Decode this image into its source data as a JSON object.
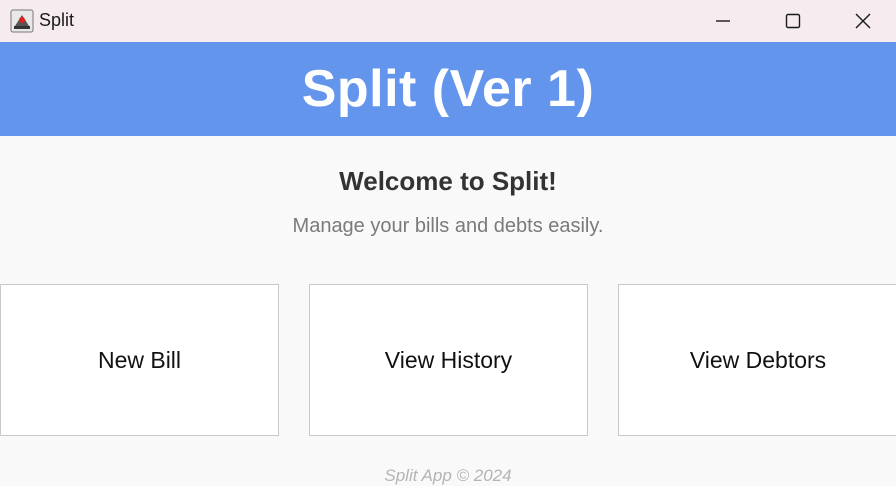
{
  "window": {
    "title": "Split",
    "icon": "java-cup-icon",
    "controls": [
      "minimize-icon",
      "maximize-icon",
      "close-icon"
    ]
  },
  "banner": {
    "title": "Split (Ver 1)",
    "background": "#6495ed"
  },
  "main": {
    "welcome": "Welcome to Split!",
    "subtitle": "Manage your bills and debts easily.",
    "buttons": [
      {
        "label": "New Bill"
      },
      {
        "label": "View History"
      },
      {
        "label": "View Debtors"
      }
    ]
  },
  "footer": {
    "text": "Split App © 2024"
  }
}
